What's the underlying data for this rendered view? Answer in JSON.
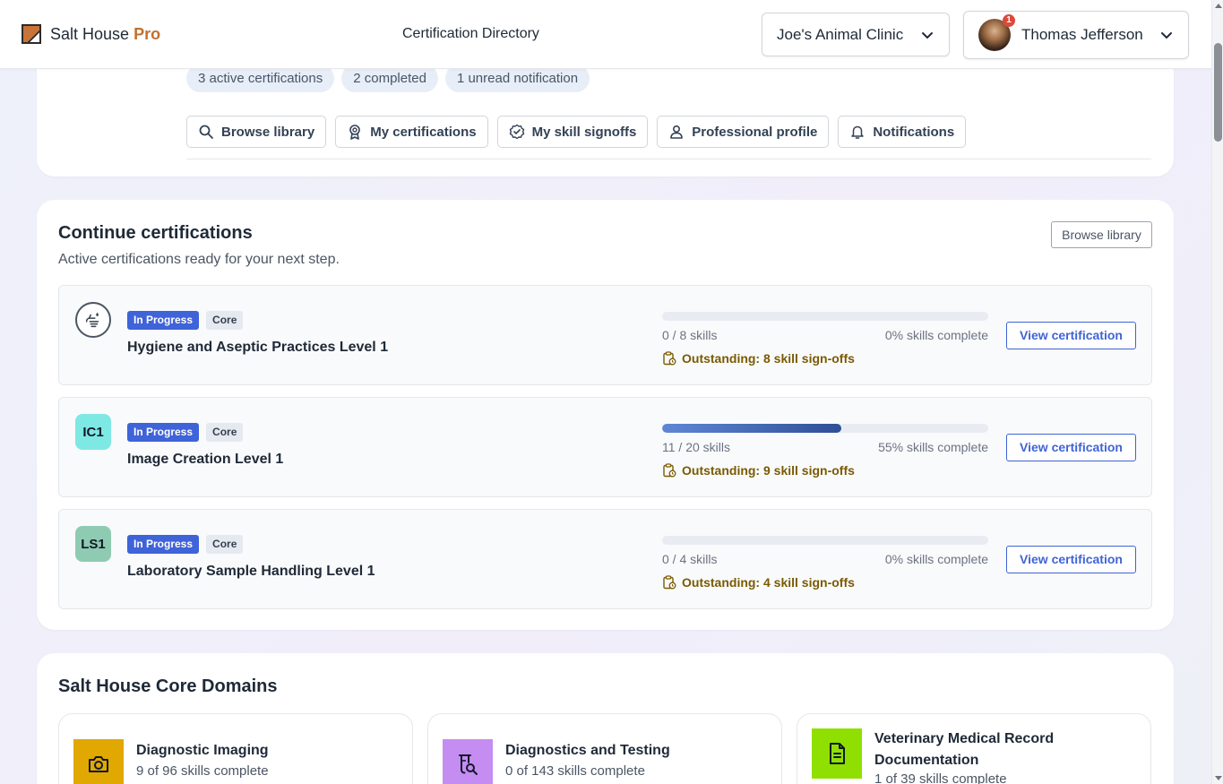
{
  "header": {
    "brand": "Salt House",
    "brand_accent": "Pro",
    "page_title": "Certification Directory",
    "clinic": "Joe's Animal Clinic",
    "user_name": "Thomas Jefferson",
    "notification_count": "1"
  },
  "summary": {
    "pills": [
      "3 active certifications",
      "2 completed",
      "1 unread notification"
    ],
    "nav": [
      {
        "label": "Browse library",
        "icon": "search-icon"
      },
      {
        "label": "My certifications",
        "icon": "award-icon"
      },
      {
        "label": "My skill signoffs",
        "icon": "badge-check-icon"
      },
      {
        "label": "Professional profile",
        "icon": "user-icon"
      },
      {
        "label": "Notifications",
        "icon": "bell-icon"
      }
    ]
  },
  "continue": {
    "title": "Continue certifications",
    "subtitle": "Active certifications ready for your next step.",
    "browse_label": "Browse library",
    "items": [
      {
        "icon_text": "",
        "status": "In Progress",
        "tier": "Core",
        "name": "Hygiene and Aseptic Practices Level 1",
        "skills": "0 / 8 skills",
        "percent_label": "0% skills complete",
        "progress": 0,
        "outstanding": "Outstanding: 8 skill sign-offs",
        "action": "View certification"
      },
      {
        "icon_text": "IC1",
        "status": "In Progress",
        "tier": "Core",
        "name": "Image Creation Level 1",
        "skills": "11 / 20 skills",
        "percent_label": "55% skills complete",
        "progress": 55,
        "outstanding": "Outstanding: 9 skill sign-offs",
        "action": "View certification"
      },
      {
        "icon_text": "LS1",
        "status": "In Progress",
        "tier": "Core",
        "name": "Laboratory Sample Handling Level 1",
        "skills": "0 / 4 skills",
        "percent_label": "0% skills complete",
        "progress": 0,
        "outstanding": "Outstanding: 4 skill sign-offs",
        "action": "View certification"
      }
    ]
  },
  "domains": {
    "title": "Salt House Core Domains",
    "items": [
      {
        "name": "Diagnostic Imaging",
        "progress": "9 of 96 skills complete",
        "color": "#e0a800",
        "icon": "camera-icon"
      },
      {
        "name": "Diagnostics and Testing",
        "progress": "0 of 143 skills complete",
        "color": "#c58cf2",
        "icon": "test-search-icon"
      },
      {
        "name": "Veterinary Medical Record Documentation",
        "progress": "1 of 39 skills complete",
        "color": "#8fe000",
        "icon": "document-icon"
      }
    ]
  },
  "colors": {
    "accent": "#3f63d8",
    "brand_accent": "#c2702e",
    "outstanding": "#7a5a00"
  }
}
